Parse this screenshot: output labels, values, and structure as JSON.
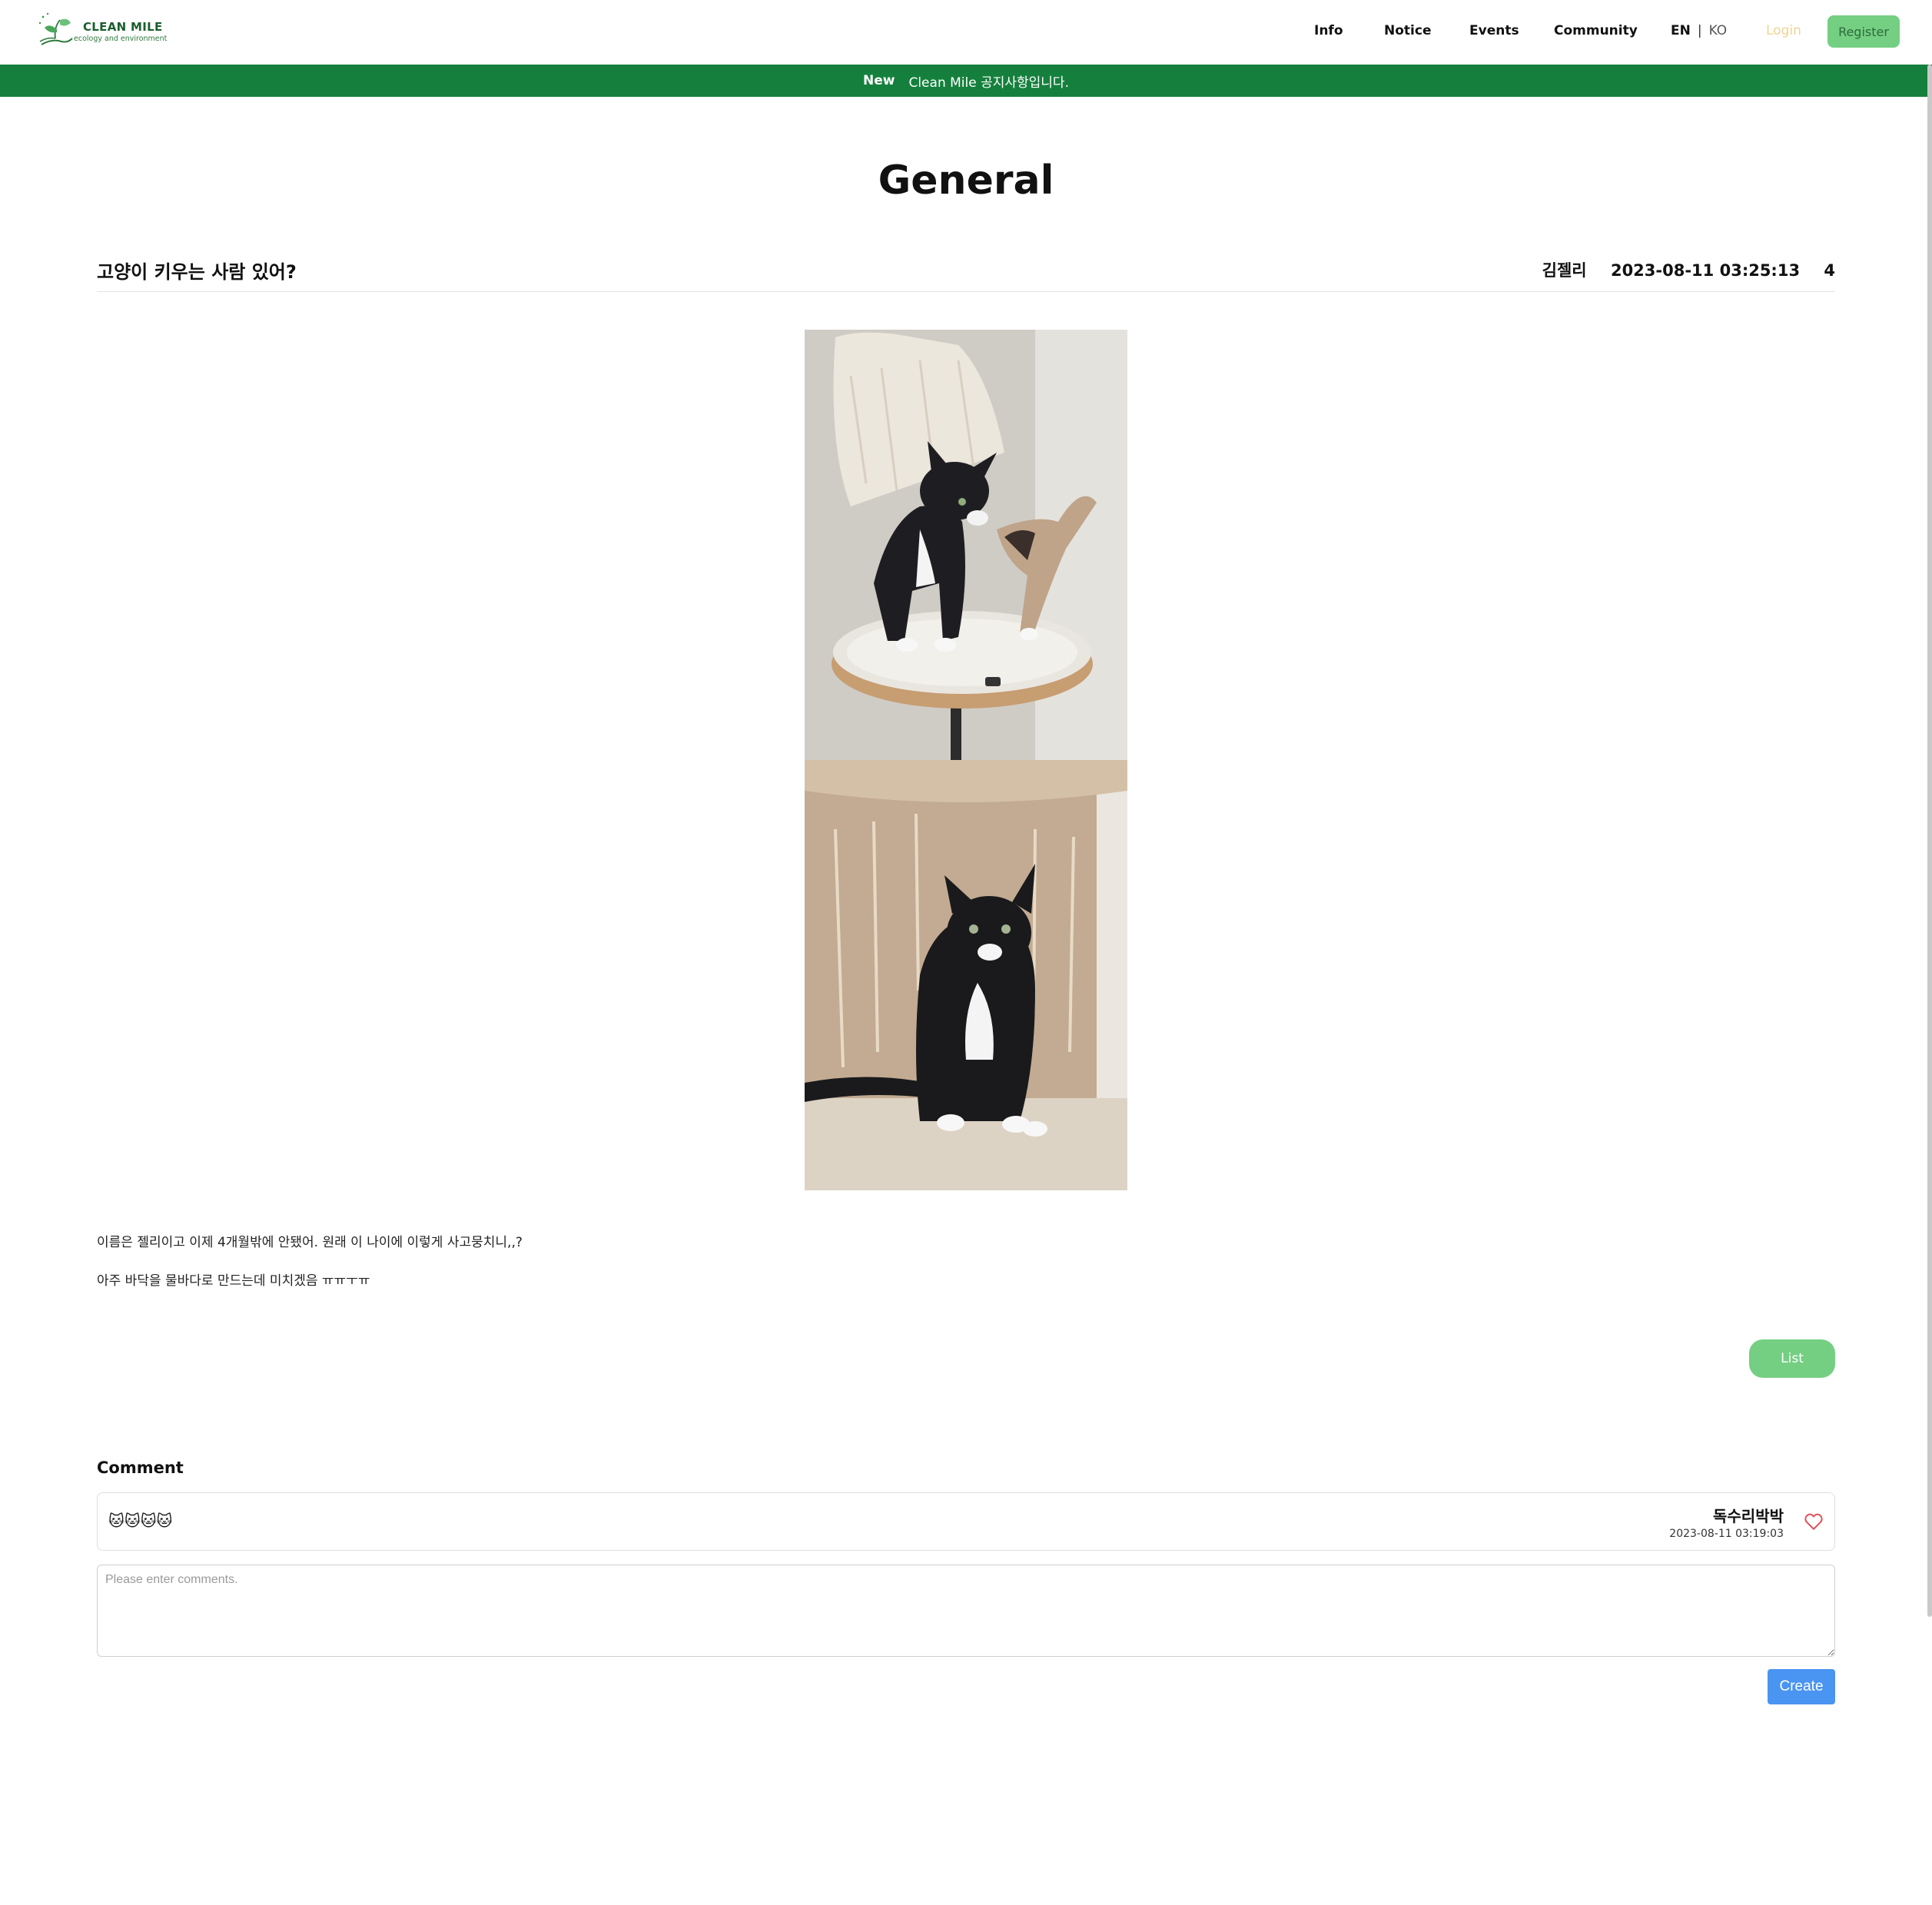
{
  "header": {
    "logo_title": "CLEAN MILE",
    "logo_subtitle": "ecology and environment",
    "nav": {
      "info": "Info",
      "notice": "Notice",
      "events": "Events",
      "community": "Community"
    },
    "lang": {
      "en": "EN",
      "sep": "|",
      "ko": "KO"
    },
    "login": "Login",
    "register": "Register"
  },
  "notice_bar": {
    "badge": "New",
    "text": "Clean Mile 공지사항입니다."
  },
  "page": {
    "title": "General"
  },
  "post": {
    "title": "고양이 키우는 사람 있어?",
    "author": "김젤리",
    "date": "2023-08-11 03:25:13",
    "views": "4",
    "body_line1": "이름은 젤리이고 이제 4개월밖에 안됐어. 원래 이 나이에 이렇게 사고뭉치니,,?",
    "body_line2": "아주 바닥을 물바다로 만드는데 미치겠음 ㅠㅠㅜㅠ",
    "list_button": "List"
  },
  "comments": {
    "label": "Comment",
    "items": [
      {
        "text": "🐱🐱🐱🐱",
        "author": "독수리박박",
        "date": "2023-08-11 03:19:03"
      }
    ],
    "input_placeholder": "Please enter comments.",
    "create_button": "Create"
  },
  "colors": {
    "brand_green": "#15803d",
    "button_green": "#74cf83",
    "create_blue": "#4a94f2",
    "login_yellow": "#f2d38f",
    "heart_red": "#e0505a"
  },
  "icons": [
    "logo-leaf-icon",
    "heart-icon"
  ]
}
